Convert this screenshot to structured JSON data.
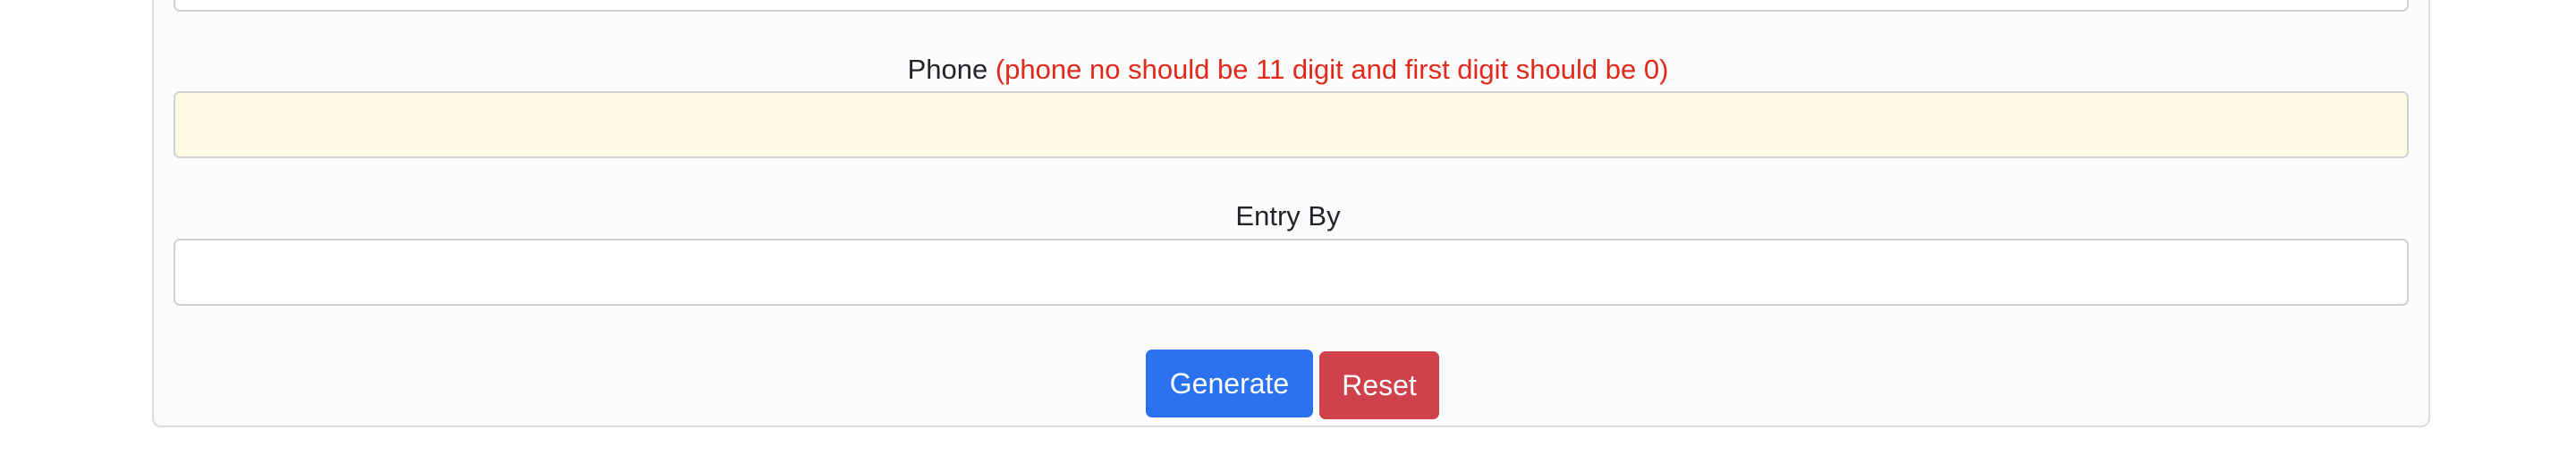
{
  "form": {
    "phone": {
      "label": "Phone",
      "hint": "(phone no should be 11 digit and first digit should be 0)",
      "value": ""
    },
    "entry_by": {
      "label": "Entry By",
      "value": ""
    }
  },
  "actions": {
    "generate_label": "Generate",
    "reset_label": "Reset"
  },
  "colors": {
    "hint": "#e2281b",
    "generate": "#2b72f0",
    "reset": "#cf414b",
    "phone_field_bg": "#fefbe2"
  }
}
